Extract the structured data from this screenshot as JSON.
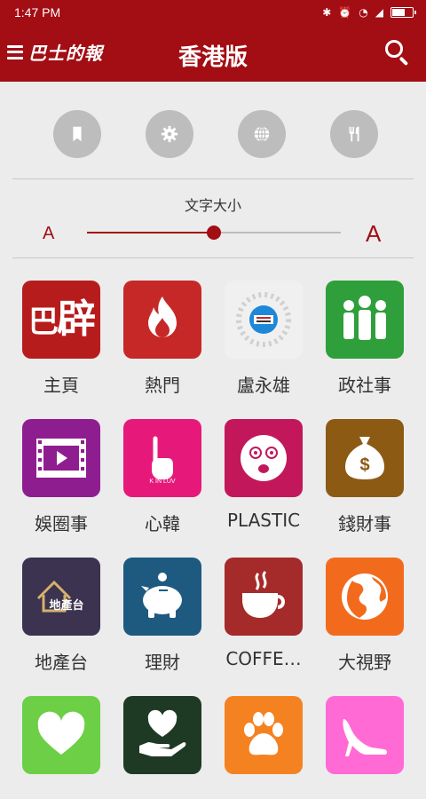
{
  "status": {
    "time": "1:47 PM",
    "icons": [
      "bluetooth-icon",
      "alarm-icon",
      "wifi-icon",
      "signal-icon",
      "battery-icon"
    ]
  },
  "appbar": {
    "brand": "巴士的報",
    "title": "香港版",
    "menu_icon": "hamburger-icon",
    "search_icon": "search-icon"
  },
  "quick_actions": [
    {
      "name": "bookmark",
      "icon": "bookmark-icon"
    },
    {
      "name": "settings",
      "icon": "gear-icon"
    },
    {
      "name": "globe",
      "icon": "globe-icon"
    },
    {
      "name": "restaurant",
      "icon": "fork-knife-icon"
    }
  ],
  "font_size": {
    "label": "文字大小",
    "small": "A",
    "large": "A",
    "level": 0.5
  },
  "categories": [
    {
      "label": "主頁",
      "color": "#b71c1c",
      "icon": "bastille-logo-icon"
    },
    {
      "label": "熱門",
      "color": "#c62828",
      "icon": "flame-icon"
    },
    {
      "label": "盧永雄",
      "color": "#f0f0f0",
      "icon": "radio-icon"
    },
    {
      "label": "政社事",
      "color": "#2e9f3a",
      "icon": "people-icon"
    },
    {
      "label": "娛圈事",
      "color": "#8e1e8f",
      "icon": "film-icon"
    },
    {
      "label": "心韓",
      "color": "#e6197b",
      "icon": "heart-hand-icon",
      "badge": "K IN LUV"
    },
    {
      "label": "PLASTIC",
      "color": "#c2185b",
      "icon": "surprised-face-icon"
    },
    {
      "label": "錢財事",
      "color": "#8d5a14",
      "icon": "money-bag-icon"
    },
    {
      "label": "地產台",
      "color": "#3b3350",
      "icon": "house-icon",
      "badge": "地產台"
    },
    {
      "label": "理財",
      "color": "#1e5a80",
      "icon": "piggy-bank-icon"
    },
    {
      "label": "COFFE…",
      "color": "#a52a2a",
      "icon": "coffee-icon"
    },
    {
      "label": "大視野",
      "color": "#f26b1d",
      "icon": "globe-icon"
    },
    {
      "label": "",
      "color": "#6ccf45",
      "icon": "heart-icon"
    },
    {
      "label": "",
      "color": "#1f3a24",
      "icon": "heart-in-hand-icon"
    },
    {
      "label": "",
      "color": "#f58220",
      "icon": "paw-icon"
    },
    {
      "label": "",
      "color": "#ff6ad5",
      "icon": "high-heel-icon"
    }
  ]
}
